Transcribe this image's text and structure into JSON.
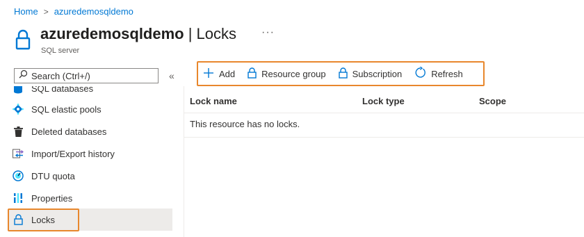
{
  "breadcrumb": {
    "home": "Home",
    "separator": ">",
    "current": "azuredemosqldemo"
  },
  "header": {
    "resource_name": "azuredemosqldemo",
    "page_name": "| Locks",
    "subtitle": "SQL server",
    "more": "···"
  },
  "search": {
    "placeholder": "Search (Ctrl+/)"
  },
  "collapse": "«",
  "sidebar": {
    "items": [
      {
        "label": "SQL databases",
        "icon": "sql-database-icon"
      },
      {
        "label": "SQL elastic pools",
        "icon": "elastic-pool-icon"
      },
      {
        "label": "Deleted databases",
        "icon": "trash-icon"
      },
      {
        "label": "Import/Export history",
        "icon": "import-export-icon"
      },
      {
        "label": "DTU quota",
        "icon": "gauge-icon"
      },
      {
        "label": "Properties",
        "icon": "properties-icon"
      },
      {
        "label": "Locks",
        "icon": "lock-icon",
        "active": true
      }
    ]
  },
  "toolbar": {
    "add": "Add",
    "resource_group": "Resource group",
    "subscription": "Subscription",
    "refresh": "Refresh"
  },
  "table": {
    "columns": [
      "Lock name",
      "Lock type",
      "Scope"
    ],
    "empty_message": "This resource has no locks."
  },
  "colors": {
    "accent": "#0078d4",
    "highlight": "#e8872c",
    "active_bg": "#edebe9"
  }
}
